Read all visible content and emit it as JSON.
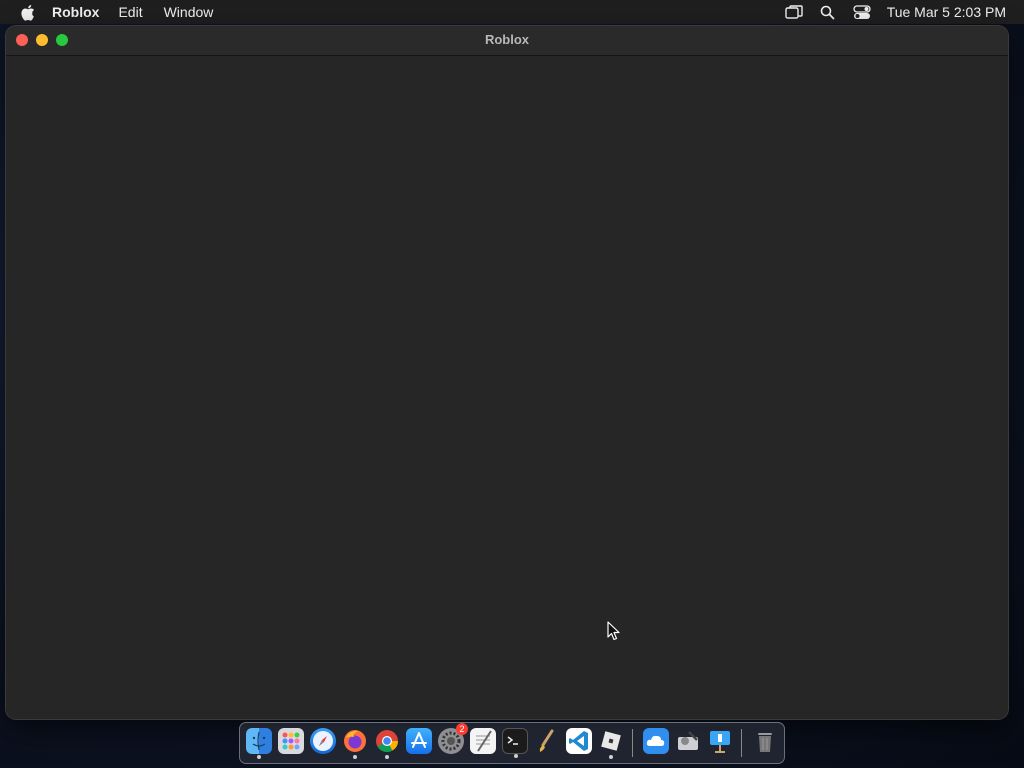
{
  "menubar": {
    "app_name": "Roblox",
    "items": [
      "Edit",
      "Window"
    ],
    "clock": "Tue Mar 5  2:03 PM",
    "status_icons": [
      "screen-mirroring-icon",
      "spotlight-search-icon",
      "control-center-icon"
    ]
  },
  "window": {
    "title": "Roblox"
  },
  "dock": {
    "apps": [
      {
        "name": "Finder",
        "icon": "finder-icon",
        "running": true
      },
      {
        "name": "Launchpad",
        "icon": "launchpad-icon",
        "running": false
      },
      {
        "name": "Safari",
        "icon": "safari-icon",
        "running": false
      },
      {
        "name": "Firefox",
        "icon": "firefox-icon",
        "running": true
      },
      {
        "name": "Chrome",
        "icon": "chrome-icon",
        "running": true
      },
      {
        "name": "App Store",
        "icon": "app-store-icon",
        "running": false
      },
      {
        "name": "System Settings",
        "icon": "system-settings-icon",
        "running": false,
        "badge": "2"
      },
      {
        "name": "TextEdit",
        "icon": "textedit-icon",
        "running": false
      },
      {
        "name": "Terminal",
        "icon": "terminal-icon",
        "running": true
      },
      {
        "name": "Roblox Studio",
        "icon": "roblox-studio-icon",
        "running": false
      },
      {
        "name": "Visual Studio Code",
        "icon": "vscode-icon",
        "running": false
      },
      {
        "name": "Roblox",
        "icon": "roblox-icon",
        "running": true
      },
      {
        "name": "iCloud Drive",
        "icon": "icloud-icon",
        "running": false
      },
      {
        "name": "Disk Utility",
        "icon": "disk-utility-icon",
        "running": false
      },
      {
        "name": "Keynote",
        "icon": "keynote-icon",
        "running": false
      },
      {
        "name": "Trash",
        "icon": "trash-icon",
        "running": false
      }
    ]
  }
}
